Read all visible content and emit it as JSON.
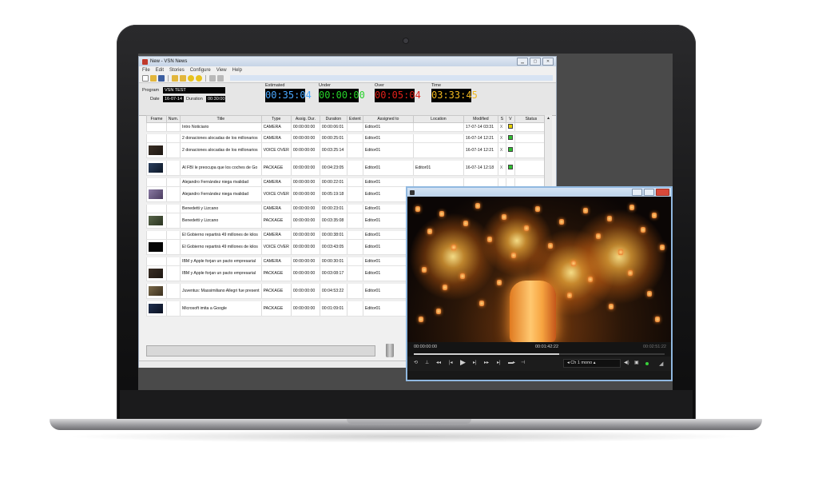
{
  "window": {
    "title": "New - VSN News",
    "menu": [
      "File",
      "Edit",
      "Stories",
      "Configure",
      "View",
      "Help"
    ]
  },
  "info": {
    "program_label": "Program",
    "program_value": "VSN TEST",
    "date_label": "Date",
    "date_value": "16-07-14",
    "duration_label": "Duration",
    "duration_value": "00:30:00",
    "estimated_label": "Estimated",
    "estimated_value": "00:35:04",
    "under_label": "Under",
    "under_value": "00:00:00",
    "over_label": "Over",
    "over_value": "00:05:04",
    "time_label": "Time",
    "time_value": "03:33:45"
  },
  "colors": {
    "estimated": "#4aa8ff",
    "under": "#27d32a",
    "over": "#e0201a",
    "time": "#f0b820",
    "status_yellow": "#e6d000",
    "status_green": "#2fbf2f"
  },
  "table": {
    "headers": [
      "Frame",
      "Num.",
      "Title",
      "Type",
      "Assig. Dur.",
      "Duration",
      "Extent",
      "Assigned to",
      "Location",
      "Modified",
      "S",
      "V",
      "Status"
    ],
    "rows": [
      {
        "thumb": "none",
        "title": "Intro Noticiario",
        "type": "CAMERA",
        "assig": "00:00:00:00",
        "dur": "00:00:06:01",
        "assigned": "Editor01",
        "location": "",
        "modified": "17-07-14 03:31",
        "s": "X",
        "v": "yellow",
        "h": "short"
      },
      {
        "gap": true
      },
      {
        "thumb": "none",
        "title": "2 donaciones alocadas de los millonarios",
        "type": "CAMERA",
        "assig": "00:00:00:00",
        "dur": "00:00:25:01",
        "assigned": "Editor01",
        "location": "",
        "modified": "16-07-14 12:21",
        "s": "X",
        "v": "green",
        "h": "short"
      },
      {
        "thumb": "dark",
        "title": "2 donaciones alocadas de los millonarios",
        "type": "VOICE OVER",
        "assig": "00:00:00:00",
        "dur": "00:03:25:14",
        "assigned": "Editor01",
        "location": "",
        "modified": "16-07-14 12:21",
        "s": "X",
        "v": "green",
        "h": "tall"
      },
      {
        "gap": true
      },
      {
        "thumb": "blue",
        "title": "Al FBI le preocupa que los coches de Go",
        "type": "PACKAGE",
        "assig": "00:00:00:00",
        "dur": "00:04:23:05",
        "assigned": "Editor01",
        "location": "Editor01",
        "modified": "16-07-14 12:18",
        "s": "X",
        "v": "green",
        "h": "tall"
      },
      {
        "gap": true
      },
      {
        "thumb": "none",
        "title": "Alejandro Fernández niega rivalidad",
        "type": "CAMERA",
        "assig": "00:00:00:00",
        "dur": "00:00:22:01",
        "assigned": "Editor01",
        "location": "",
        "modified": "",
        "s": "",
        "v": "",
        "h": "short"
      },
      {
        "thumb": "purple",
        "title": "Alejandro Fernández niega rivalidad",
        "type": "VOICE OVER",
        "assig": "00:00:00:00",
        "dur": "00:05:19:18",
        "assigned": "Editor01",
        "location": "",
        "modified": "",
        "s": "",
        "v": "",
        "h": "tall"
      },
      {
        "gap": true
      },
      {
        "thumb": "none",
        "title": "Benedetti y Lizcano",
        "type": "CAMERA",
        "assig": "00:00:00:00",
        "dur": "00:00:23:01",
        "assigned": "Editor01",
        "location": "",
        "modified": "",
        "s": "",
        "v": "",
        "h": "short"
      },
      {
        "thumb": "green",
        "title": "Benedetti y Lizcano",
        "type": "PACKAGE",
        "assig": "00:00:00:00",
        "dur": "00:03:35:08",
        "assigned": "Editor01",
        "location": "",
        "modified": "",
        "s": "",
        "v": "",
        "h": "tall"
      },
      {
        "gap": true
      },
      {
        "thumb": "none",
        "title": "El Gobierno repartirá 49 millones de kilos",
        "type": "CAMERA",
        "assig": "00:00:00:00",
        "dur": "00:00:38:01",
        "assigned": "Editor01",
        "location": "",
        "modified": "",
        "s": "",
        "v": "",
        "h": "short"
      },
      {
        "thumb": "black",
        "title": "El Gobierno repartirá 49 millones de kilos",
        "type": "VOICE OVER",
        "assig": "00:00:00:00",
        "dur": "00:03:43:05",
        "assigned": "Editor01",
        "location": "",
        "modified": "",
        "s": "",
        "v": "",
        "h": "tall"
      },
      {
        "gap": true
      },
      {
        "thumb": "none",
        "title": "IBM y Apple forjan un pacto empresarial",
        "type": "CAMERA",
        "assig": "00:00:00:00",
        "dur": "00:00:30:01",
        "assigned": "Editor01",
        "location": "",
        "modified": "",
        "s": "",
        "v": "",
        "h": "short"
      },
      {
        "thumb": "dark",
        "title": "IBM y Apple forjan un pacto empresarial",
        "type": "PACKAGE",
        "assig": "00:00:00:00",
        "dur": "00:03:08:17",
        "assigned": "Editor01",
        "location": "",
        "modified": "",
        "s": "",
        "v": "",
        "h": "tall"
      },
      {
        "gap": true
      },
      {
        "thumb": "brown",
        "title": "Juventus: Massimiliano Allegri fue present",
        "type": "PACKAGE",
        "assig": "00:00:00:00",
        "dur": "00:04:53:22",
        "assigned": "Editor01",
        "location": "",
        "modified": "",
        "s": "",
        "v": "",
        "h": "tall"
      },
      {
        "gap": true
      },
      {
        "thumb": "navy",
        "title": "Microsoft imita a Google",
        "type": "PACKAGE",
        "assig": "00:00:00:00",
        "dur": "00:01:09:01",
        "assigned": "Editor01",
        "location": "",
        "modified": "",
        "s": "",
        "v": "",
        "h": "tall"
      }
    ]
  },
  "player": {
    "time_current": "00:00:00:00",
    "time_position": "00:01:42:22",
    "time_end": "00:02:51:22",
    "progress": 0.58,
    "channel": "Ch 1 mono"
  }
}
